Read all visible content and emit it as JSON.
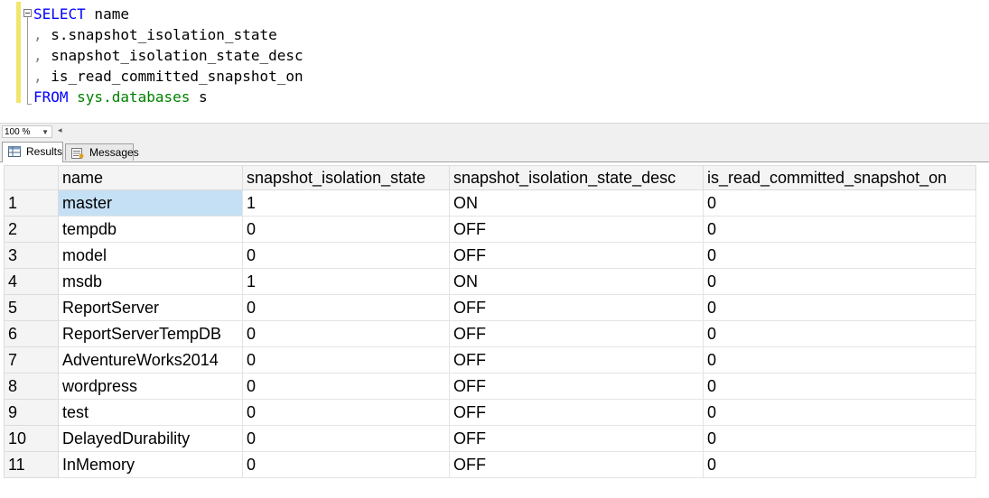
{
  "editor": {
    "lines": [
      {
        "kw": "SELECT",
        "rest": " name"
      },
      {
        "punc": ",",
        "rest": " s.snapshot_isolation_state"
      },
      {
        "punc": ",",
        "rest": " snapshot_isolation_state_desc"
      },
      {
        "punc": ",",
        "rest": " is_read_committed_snapshot_on"
      },
      {
        "kw": "FROM",
        "sys": " sys.databases",
        "rest": " s"
      }
    ]
  },
  "zoom": {
    "level": "100 %"
  },
  "tabs": {
    "results": "Results",
    "messages": "Messages"
  },
  "grid": {
    "columns": [
      "name",
      "snapshot_isolation_state",
      "snapshot_isolation_state_desc",
      "is_read_committed_snapshot_on"
    ],
    "rows": [
      [
        "1",
        "master",
        "1",
        "ON",
        "0"
      ],
      [
        "2",
        "tempdb",
        "0",
        "OFF",
        "0"
      ],
      [
        "3",
        "model",
        "0",
        "OFF",
        "0"
      ],
      [
        "4",
        "msdb",
        "1",
        "ON",
        "0"
      ],
      [
        "5",
        "ReportServer",
        "0",
        "OFF",
        "0"
      ],
      [
        "6",
        "ReportServerTempDB",
        "0",
        "OFF",
        "0"
      ],
      [
        "7",
        "AdventureWorks2014",
        "0",
        "OFF",
        "0"
      ],
      [
        "8",
        "wordpress",
        "0",
        "OFF",
        "0"
      ],
      [
        "9",
        "test",
        "0",
        "OFF",
        "0"
      ],
      [
        "10",
        "DelayedDurability",
        "0",
        "OFF",
        "0"
      ],
      [
        "11",
        "InMemory",
        "0",
        "OFF",
        "0"
      ]
    ]
  }
}
